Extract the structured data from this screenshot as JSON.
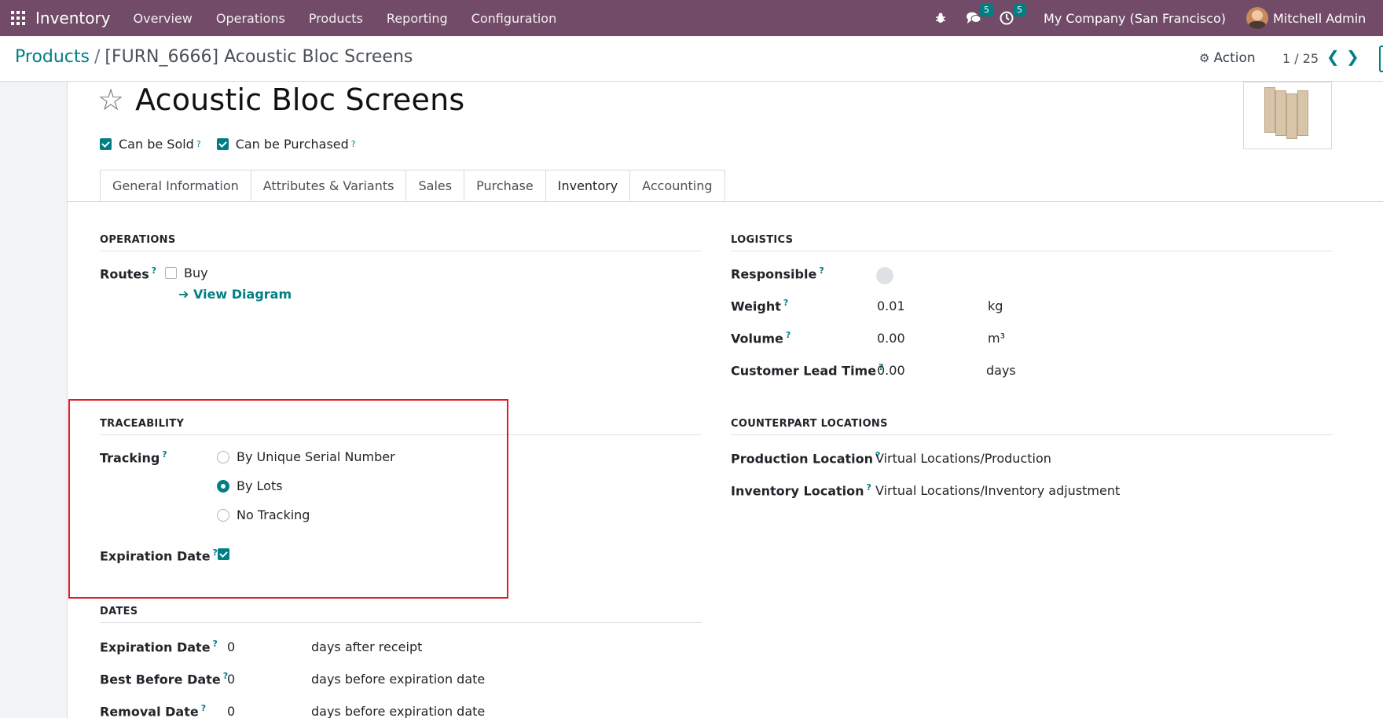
{
  "navbar": {
    "app_name": "Inventory",
    "menu": [
      "Overview",
      "Operations",
      "Products",
      "Reporting",
      "Configuration"
    ],
    "messages_count": "5",
    "activities_count": "5",
    "company": "My Company (San Francisco)",
    "user": "Mitchell Admin"
  },
  "control_panel": {
    "breadcrumb_parent": "Products",
    "breadcrumb_separator": "/",
    "breadcrumb_current": "[FURN_6666] Acoustic Bloc Screens",
    "action_label": "Action",
    "pager": "1 / 25"
  },
  "product": {
    "name": "Acoustic Bloc Screens",
    "can_be_sold_label": "Can be Sold",
    "can_be_purchased_label": "Can be Purchased",
    "help_mark": "?"
  },
  "tabs": [
    "General Information",
    "Attributes & Variants",
    "Sales",
    "Purchase",
    "Inventory",
    "Accounting"
  ],
  "operations": {
    "title": "OPERATIONS",
    "routes_label": "Routes",
    "route_buy": "Buy",
    "view_diagram": "View Diagram"
  },
  "traceability": {
    "title": "TRACEABILITY",
    "tracking_label": "Tracking",
    "options": [
      "By Unique Serial Number",
      "By Lots",
      "No Tracking"
    ],
    "selected": "By Lots",
    "expiration_label": "Expiration Date"
  },
  "dates": {
    "title": "DATES",
    "rows": [
      {
        "label": "Expiration Date",
        "value": "0",
        "unit": "days after receipt"
      },
      {
        "label": "Best Before Date",
        "value": "0",
        "unit": "days before expiration date"
      },
      {
        "label": "Removal Date",
        "value": "0",
        "unit": "days before expiration date"
      }
    ]
  },
  "logistics": {
    "title": "LOGISTICS",
    "responsible_label": "Responsible",
    "weight_label": "Weight",
    "weight_value": "0.01",
    "weight_unit": "kg",
    "volume_label": "Volume",
    "volume_value": "0.00",
    "volume_unit": "m³",
    "lead_time_label": "Customer Lead Time",
    "lead_time_value": "0.00",
    "lead_time_unit": "days"
  },
  "counterpart": {
    "title": "COUNTERPART LOCATIONS",
    "production_label": "Production Location",
    "production_value": "Virtual Locations/Production",
    "inventory_label": "Inventory Location",
    "inventory_value": "Virtual Locations/Inventory adjustment"
  },
  "colors": {
    "brand": "#714b67",
    "accent": "#017e84",
    "highlight": "#e01b24"
  }
}
